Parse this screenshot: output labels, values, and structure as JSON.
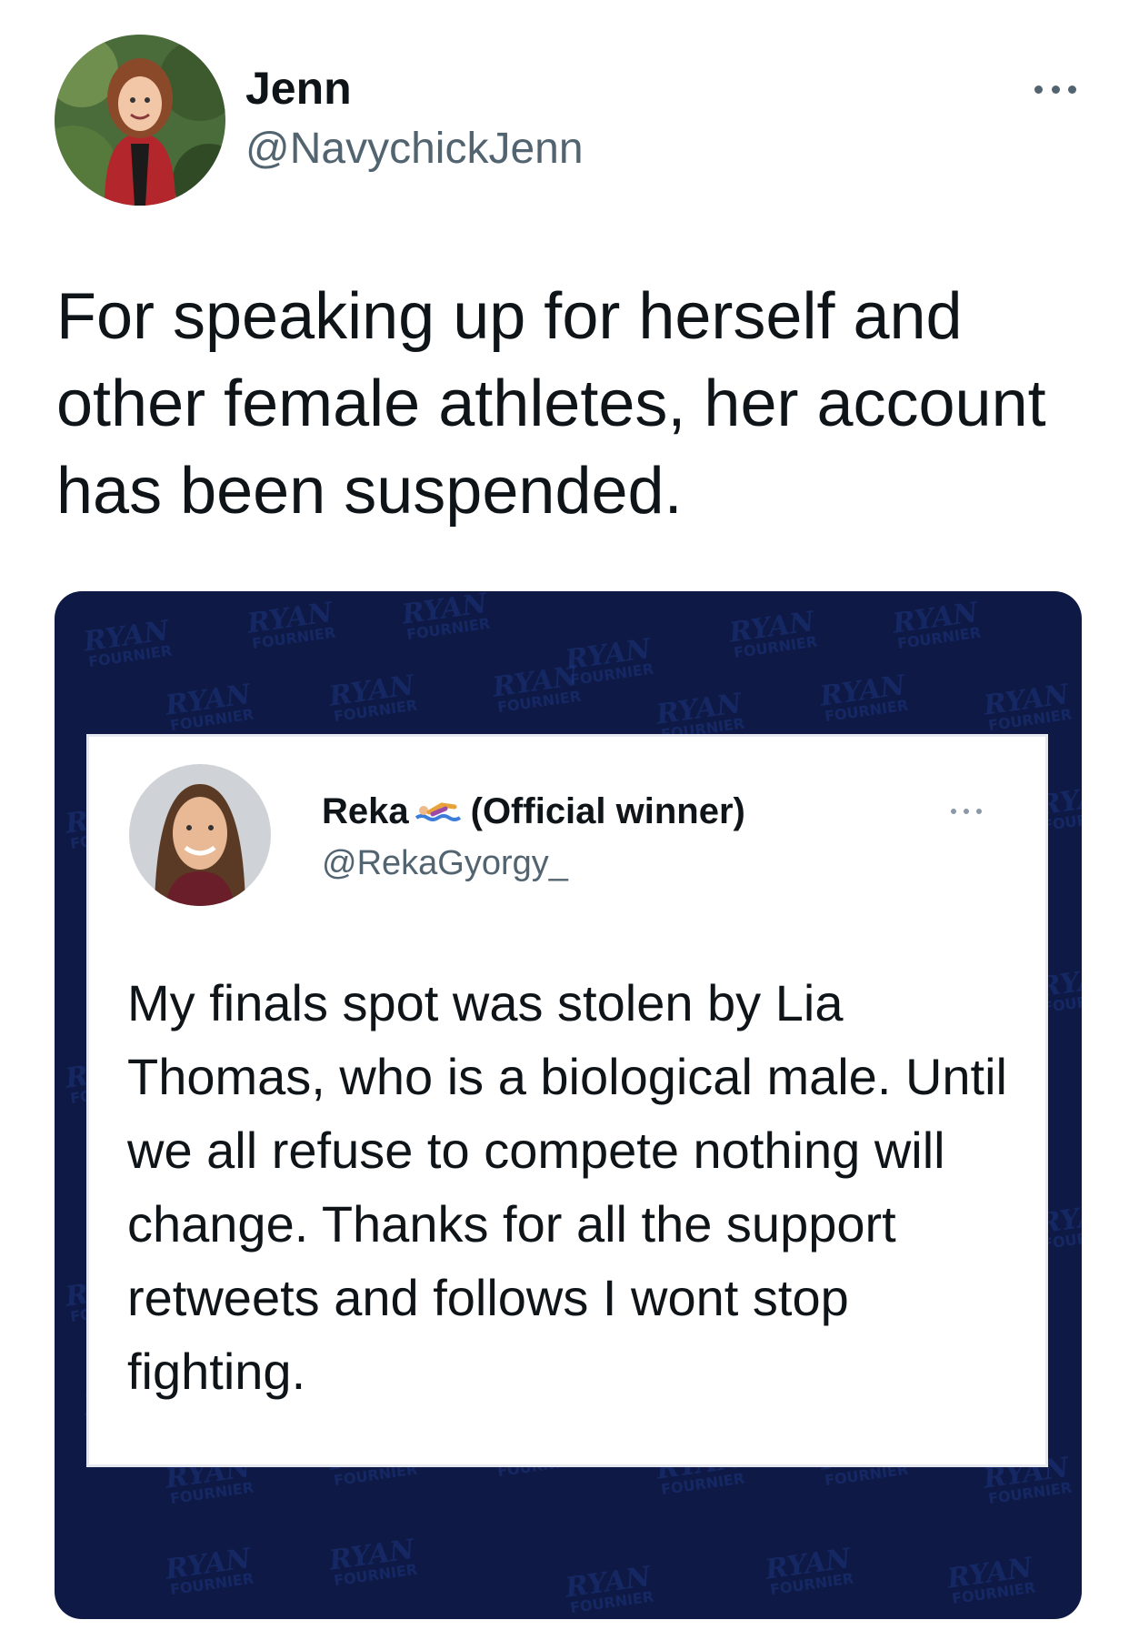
{
  "tweet": {
    "display_name": "Jenn",
    "handle": "@NavychickJenn",
    "text": "For speaking up for herself and other female athletes, her account has been suspended.",
    "avatar_icon": "profile-photo-icon",
    "more_icon": "more-options-icon"
  },
  "media": {
    "background_color": "#0e1a45",
    "watermark_text_top": "RYAN",
    "watermark_text_bottom": "FOURNIER",
    "quoted_tweet": {
      "display_name": "Reka",
      "badge_icon": "swimmer-emoji-icon",
      "name_suffix": "(Official winner)",
      "handle": "@RekaGyorgy_",
      "text": "My finals spot was stolen by Lia Thomas, who is a biological male. Until we all refuse to compete nothing will change. Thanks for all the support retweets and follows I wont stop fighting."
    }
  },
  "colors": {
    "text_primary": "#0f1419",
    "text_secondary": "#536471",
    "media_bg": "#0e1a45"
  }
}
